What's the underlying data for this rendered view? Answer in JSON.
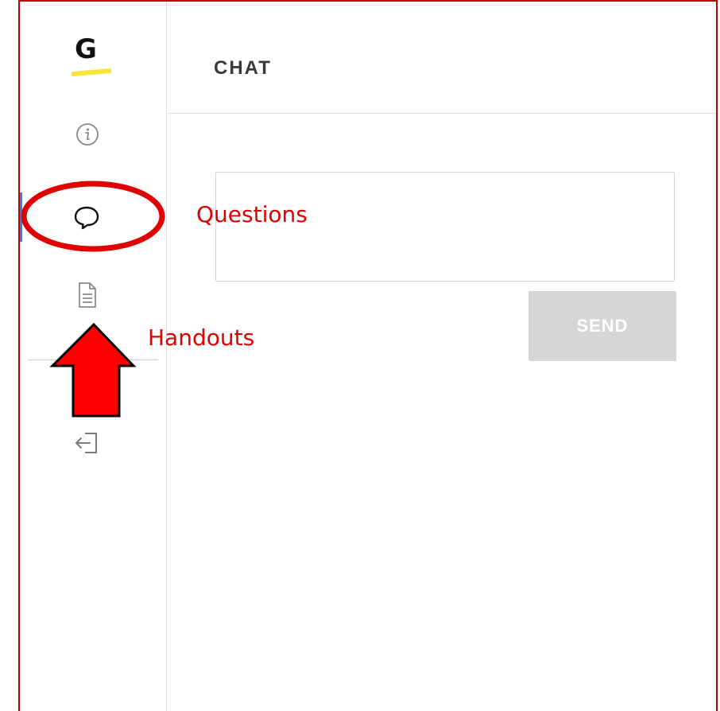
{
  "sidebar": {
    "logo_letter": "G",
    "items": [
      {
        "name": "info",
        "icon": "info-icon"
      },
      {
        "name": "chat",
        "icon": "chat-bubble-icon",
        "active": true
      },
      {
        "name": "handouts",
        "icon": "document-icon"
      },
      {
        "name": "exit",
        "icon": "exit-icon"
      }
    ]
  },
  "header": {
    "title": "CHAT"
  },
  "chat": {
    "input_value": "",
    "send_label": "SEND"
  },
  "annotations": {
    "questions_label": "Questions",
    "handouts_label": "Handouts",
    "color": "#e00000"
  },
  "colors": {
    "frame_border": "#c00000",
    "active_indicator": "#1e88e5",
    "send_disabled_bg": "#d6d6d6",
    "logo_highlight": "#f5e43a"
  }
}
